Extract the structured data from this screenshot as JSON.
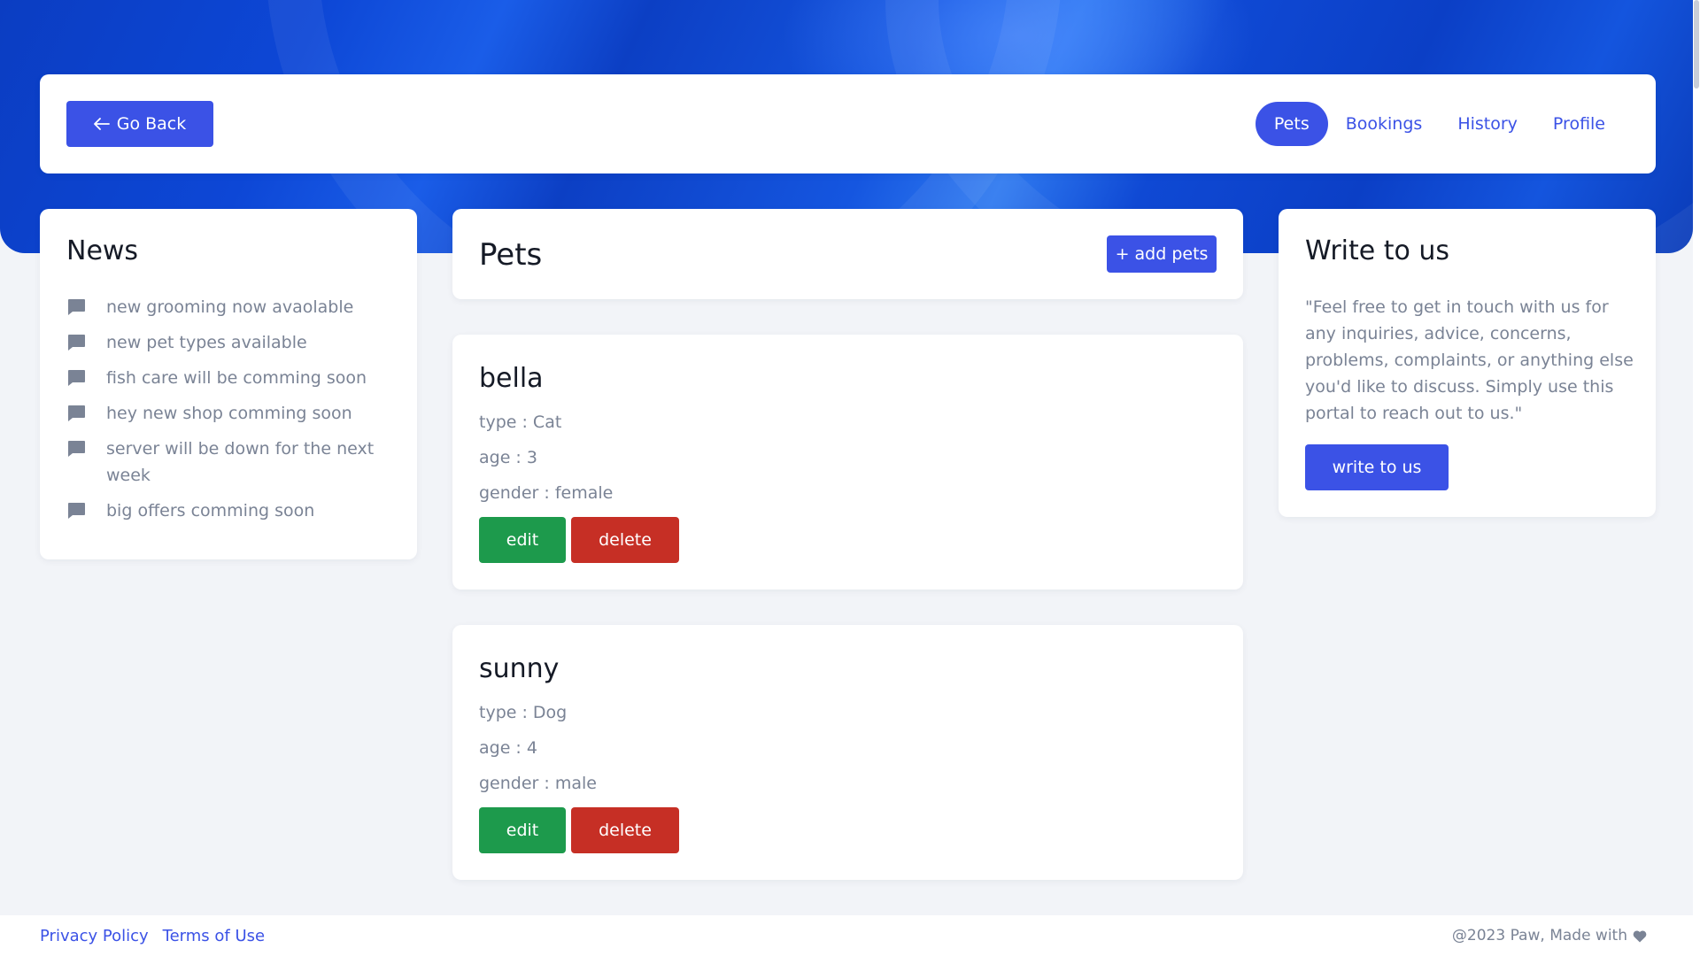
{
  "header": {
    "go_back_label": "Go Back",
    "nav": [
      {
        "label": "Pets",
        "active": true
      },
      {
        "label": "Bookings",
        "active": false
      },
      {
        "label": "History",
        "active": false
      },
      {
        "label": "Profile",
        "active": false
      }
    ]
  },
  "news": {
    "title": "News",
    "items": [
      "new grooming now avaolable",
      "new pet types available",
      "fish care will be comming soon",
      "hey new shop comming soon",
      "server will be down for the next week",
      "big offers comming soon"
    ]
  },
  "pets": {
    "title": "Pets",
    "add_label": "+ add pets",
    "list": [
      {
        "name": "bella",
        "type": "type : Cat",
        "age": "age : 3",
        "gender": "gender : female"
      },
      {
        "name": "sunny",
        "type": "type : Dog",
        "age": "age : 4",
        "gender": "gender : male"
      }
    ],
    "edit_label": "edit",
    "delete_label": "delete"
  },
  "write": {
    "title": "Write to us",
    "text": "\"Feel free to get in touch with us for any inquiries, advice, concerns, problems, complaints, or anything else you'd like to discuss. Simply use this portal to reach out to us.\"",
    "button_label": "write to us"
  },
  "footer": {
    "privacy_label": "Privacy Policy",
    "terms_label": "Terms of Use",
    "copyright": "@2023 Paw, Made with"
  },
  "colors": {
    "primary": "#3b52e6",
    "edit": "#1d9a4c",
    "delete": "#c62f25",
    "hero": "#0d47d6"
  }
}
